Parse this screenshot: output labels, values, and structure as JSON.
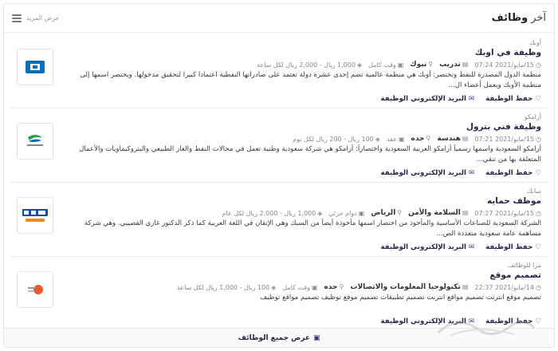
{
  "header": {
    "title_pre": "آخر",
    "title_main": "وظائف",
    "view_more_label": "عرض المزيد",
    "menu_icon": "hamburger-icon"
  },
  "jobs": [
    {
      "company": "أوبك",
      "title": "وظيفة في اوبك",
      "date": "15/مايو/2021 07:24",
      "category": "تدريب",
      "city": "تبوك",
      "type": "وقت كامل",
      "salary": "1,000 ريال - 2,000 ريال لكل ساعة",
      "desc": "منظمة الدول المصدرة للنفط وتختصر: أوبك هي منظمة عالمية تضم إحدى عشرة دولة تعتمد على صادراتها النفطية اعتمادا كبيرا لتحقيق مدخولها. ويختصر اسمها إلى منظمة الأوبك ويعمل أعضاء ال...",
      "save_label": "حفظ الوظيفة",
      "email_label": "البريد الإلكتروني الوظيفة",
      "logo": "opec-logo"
    },
    {
      "company": "أرامكو",
      "title": "وظيفة فني بترول",
      "date": "15/مايو/2021 07:21",
      "category": "هندسة",
      "city": "جده",
      "type": "عقد",
      "salary": "100 ريال - 200 ريال لكل يوم",
      "desc": "أرامكو السعودية واسمها رسمياً أرامكو العربية السعودية واختصاراً: أرامكو هي شركة سعودية وطنية تعمل في مجالات النفط والغاز الطبيعي والبتروكيماويات والأعمال المتعلقة بها من تنقي...",
      "save_label": "حفظ الوظيفة",
      "email_label": "البريد الإلكتروني الوظيفة",
      "logo": "aramco-logo"
    },
    {
      "company": "سابك",
      "title": "موظف حمايه",
      "date": "15/مايو/2021 07:27",
      "category": "السلامة والأمن",
      "city": "الرياض",
      "type": "دوام جزئي",
      "salary": "1,000 ريال - 2,000 ريال لكل عام",
      "desc": "الشركة السعودية للصناعات الأساسية والمأخوذ من اختصار اسمها مأخوذة أيضاً من السبك وهي الإتقان في اللغة العربية كما ذكر الدكتور غازي القصيبي. وهي شركة مساهمة عامة سعودية متعددة الص...",
      "save_label": "حفظ الوظيفة",
      "email_label": "البريد الإلكتروني الوظيفة",
      "logo": "sabic-logo"
    },
    {
      "company": "مزا للوظائف",
      "title": "تصميم موقع",
      "date": "14/مايو/2021 22:37",
      "category": "تكنولوجيا المعلومات والاتصالات",
      "city": "جده",
      "type": "وقت كامل",
      "salary": "100 ريال - 1,000 ريال لكل ساعة",
      "desc": "تصميم موقع انترنت تصميم مواقع انترنت تصميم تطبيقات تصميم موقع توظيف تصميم مواقع توظيف",
      "save_label": "حفظ الوظيفة",
      "email_label": "البريد الإلكتروني الوظيفة",
      "logo": "misc-logo"
    }
  ],
  "footer": {
    "view_all_label": "عرض جميع الوظائف"
  },
  "colors": {
    "accent": "#2d2346",
    "icon": "#3b2f7a",
    "opec_blue": "#0b6fb3",
    "aramco_green": "#2a9d4a",
    "sabic_blue": "#1c4b9b",
    "sabic_orange": "#f08a1c"
  }
}
